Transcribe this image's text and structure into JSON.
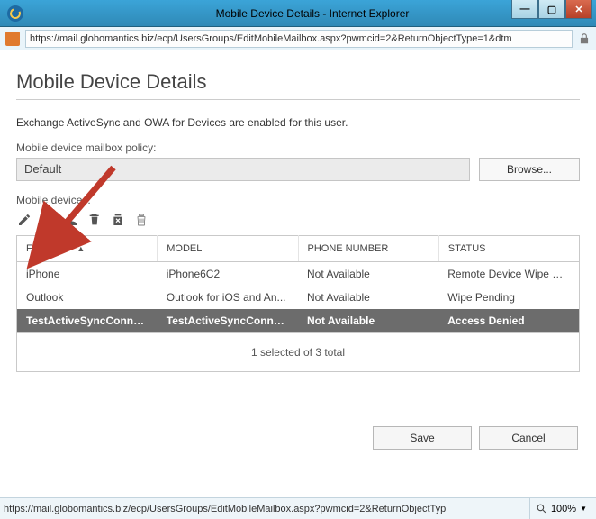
{
  "window": {
    "title": "Mobile Device Details - Internet Explorer",
    "url": "https://mail.globomantics.biz/ecp/UsersGroups/EditMobileMailbox.aspx?pwmcid=2&ReturnObjectType=1&dtm"
  },
  "page": {
    "heading": "Mobile Device Details",
    "info_text": "Exchange ActiveSync and OWA for Devices are enabled for this user.",
    "policy_label": "Mobile device mailbox policy:",
    "policy_value": "Default",
    "browse_label": "Browse...",
    "devices_label": "Mobile devices:"
  },
  "grid": {
    "columns": {
      "family": "FAMILY",
      "model": "MODEL",
      "phone": "PHONE NUMBER",
      "status": "STATUS"
    },
    "rows": [
      {
        "family": "iPhone",
        "model": "iPhone6C2",
        "phone": "Not Available",
        "status": "Remote Device Wipe Su...",
        "selected": false
      },
      {
        "family": "Outlook",
        "model": "Outlook for iOS and An...",
        "phone": "Not Available",
        "status": "Wipe Pending",
        "selected": false
      },
      {
        "family": "TestActiveSyncConnect...",
        "model": "TestActiveSyncConnect...",
        "phone": "Not Available",
        "status": "Access Denied",
        "selected": true
      }
    ],
    "footer": "1 selected of 3 total"
  },
  "buttons": {
    "save": "Save",
    "cancel": "Cancel"
  },
  "statusbar": {
    "text": "https://mail.globomantics.biz/ecp/UsersGroups/EditMobileMailbox.aspx?pwmcid=2&ReturnObjectTyp",
    "zoom": "100%"
  }
}
